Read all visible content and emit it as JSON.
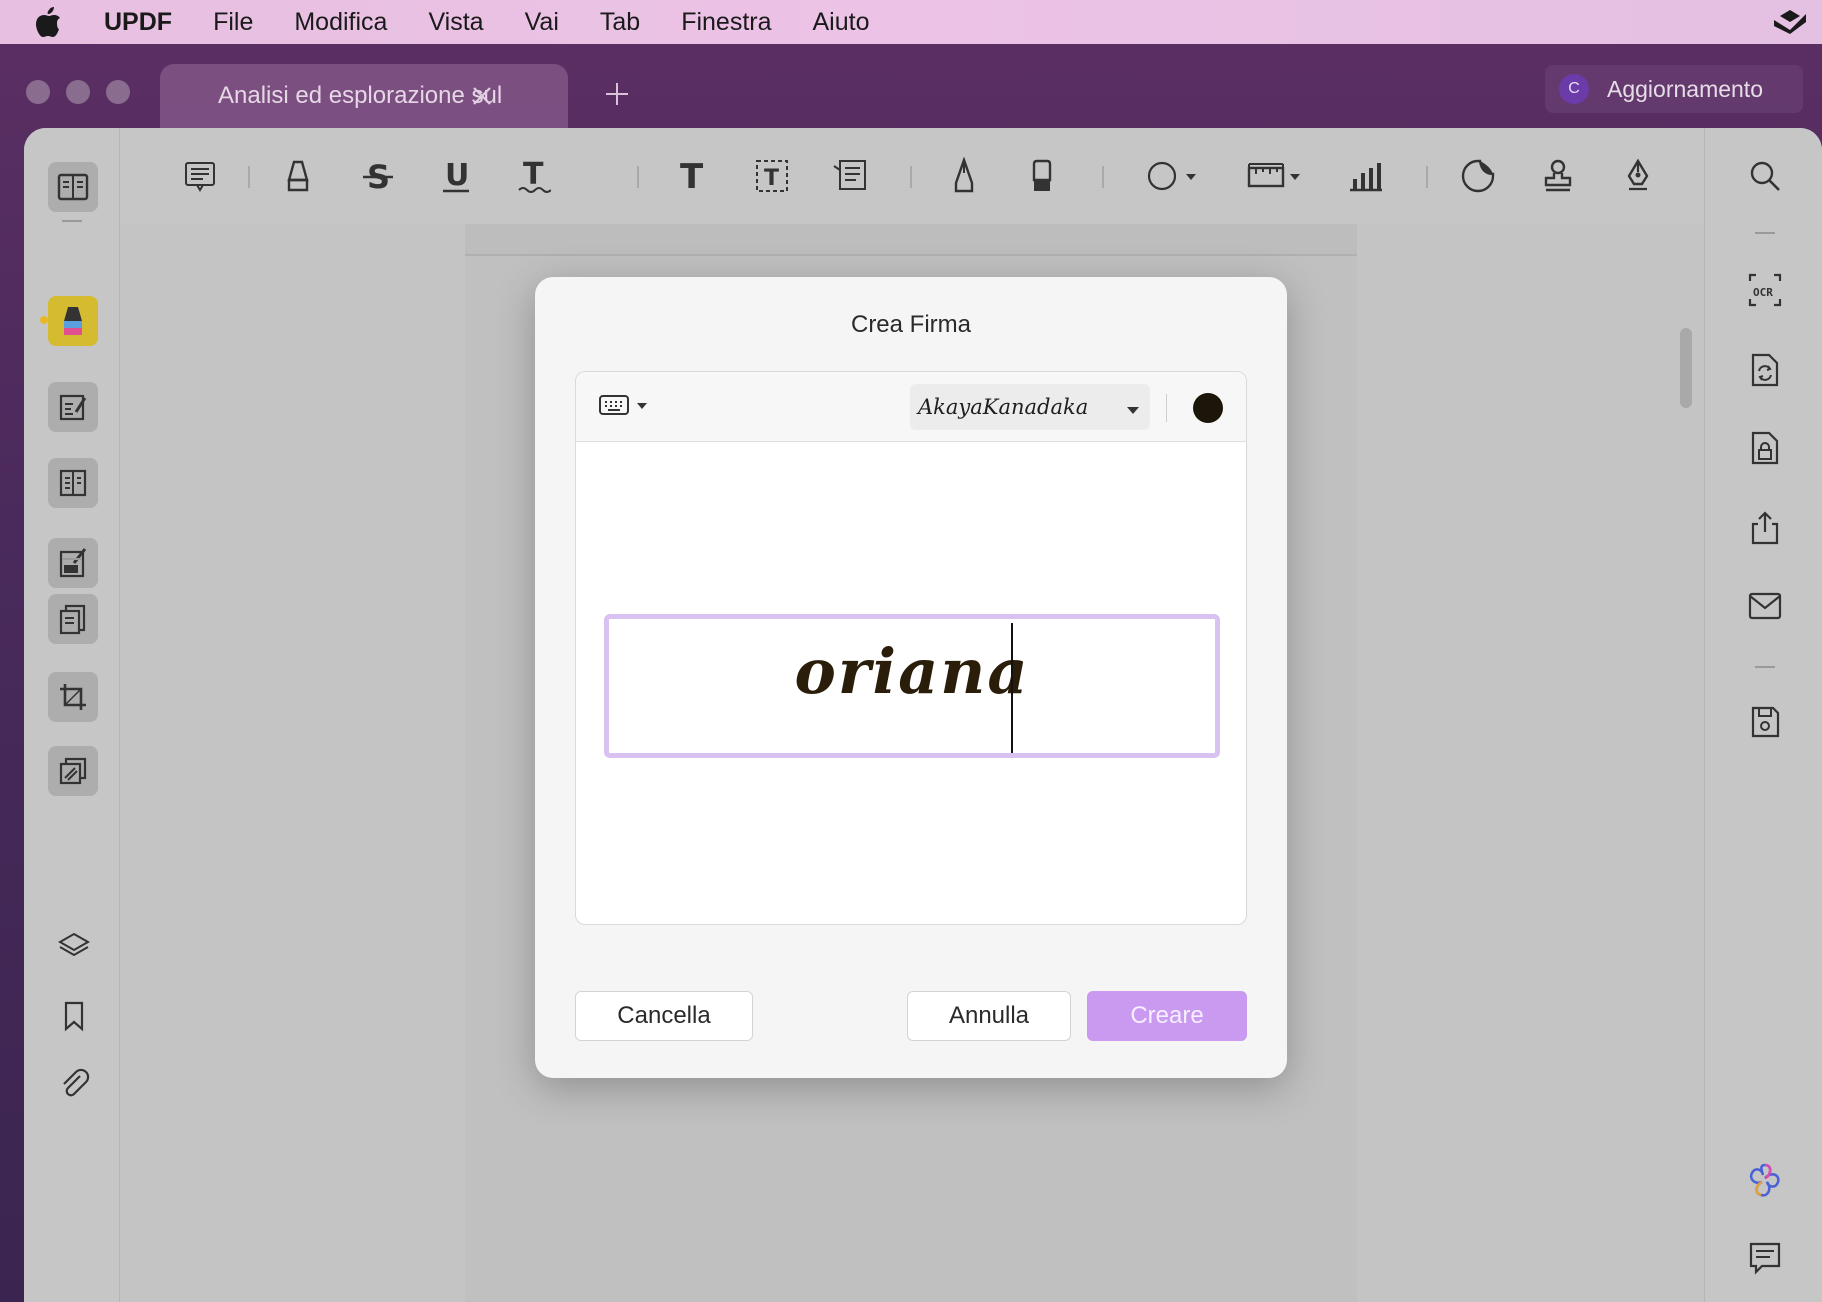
{
  "menubar": {
    "app_name": "UPDF",
    "items": [
      "File",
      "Modifica",
      "Vista",
      "Vai",
      "Tab",
      "Finestra",
      "Aiuto"
    ]
  },
  "window": {
    "tab_title": "Analisi ed esplorazione sul",
    "upgrade_avatar": "C",
    "upgrade_label": "Aggiornamento"
  },
  "dialog": {
    "title": "Crea Firma",
    "font_name": "AkayaKanadaka",
    "signature_text": "oriana",
    "ink_color": "#1c1509",
    "buttons": {
      "clear": "Cancella",
      "cancel": "Annulla",
      "create": "Creare"
    }
  },
  "colors": {
    "accent": "#c99af0",
    "input_border": "#d9c2f2",
    "active_tool": "#d4bb2f"
  }
}
